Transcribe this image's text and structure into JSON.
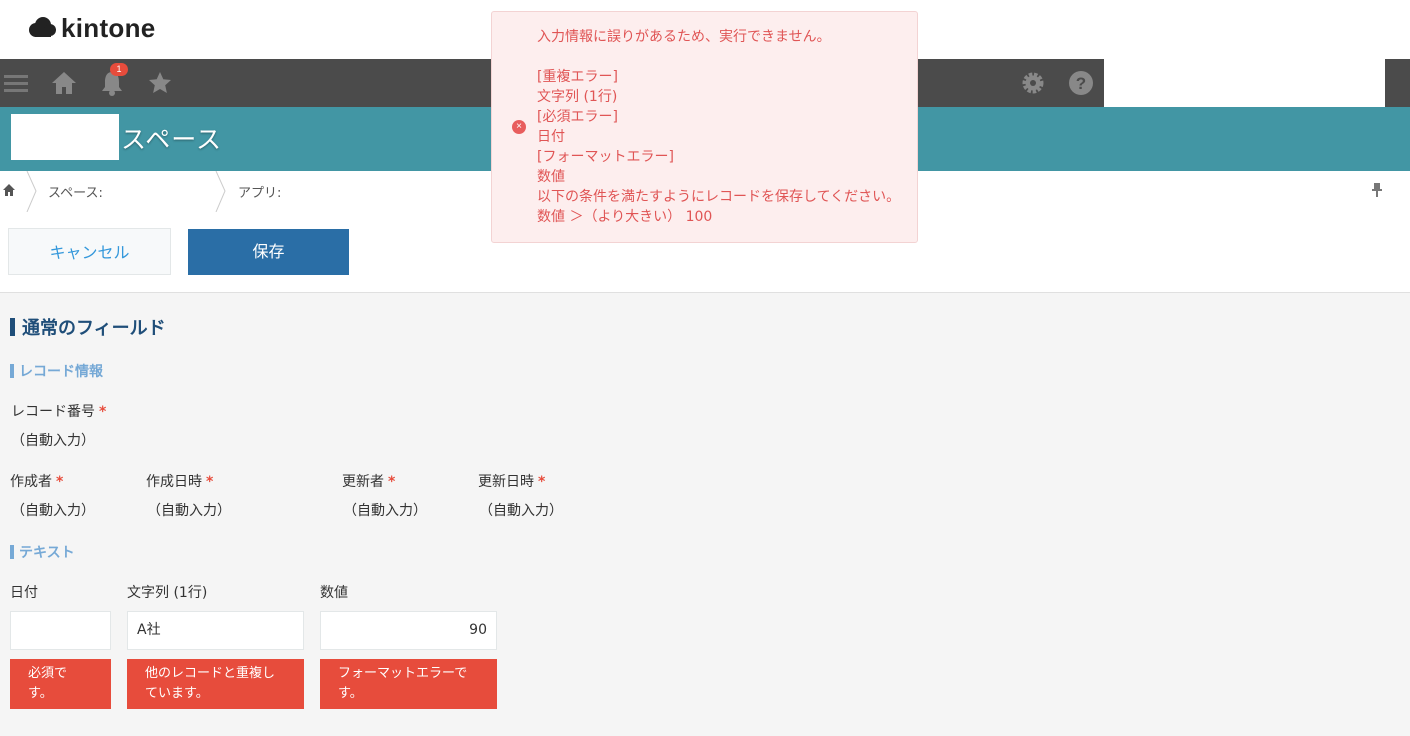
{
  "brand": {
    "name": "kintone"
  },
  "header": {
    "notification_count": "1"
  },
  "space": {
    "title": "スペース"
  },
  "breadcrumb": {
    "space_label": "スペース:",
    "app_label": "アプリ:"
  },
  "toolbar": {
    "cancel_label": "キャンセル",
    "save_label": "保存"
  },
  "form": {
    "section_title": "通常のフィールド",
    "record_info_title": "レコード情報",
    "required_mark": "*",
    "record_number": {
      "label": "レコード番号",
      "value": "（自動入力）"
    },
    "creator": {
      "label": "作成者",
      "value": "（自動入力）"
    },
    "created_at": {
      "label": "作成日時",
      "value": "（自動入力）"
    },
    "updater": {
      "label": "更新者",
      "value": "（自動入力）"
    },
    "updated_at": {
      "label": "更新日時",
      "value": "（自動入力）"
    },
    "text_group_title": "テキスト",
    "date_field": {
      "label": "日付",
      "value": "",
      "error_line1": "必須で",
      "error_line2": "す。"
    },
    "text_field": {
      "label": "文字列 (1行)",
      "value": "A社",
      "error_line1": "他のレコードと重複し",
      "error_line2": "ています。"
    },
    "number_field": {
      "label": "数値",
      "value": "90",
      "error_line1": "フォーマットエラーで",
      "error_line2": "す。"
    }
  },
  "alert": {
    "lines": [
      "入力情報に誤りがあるため、実行できません。",
      "",
      "[重複エラー]",
      "文字列 (1行)",
      "[必須エラー]",
      "日付",
      "[フォーマットエラー]",
      "数値",
      "以下の条件を満たすようにレコードを保存してください。",
      "数値 ＞（より大きい） 100"
    ]
  },
  "colors": {
    "header_bar": "#4b4b4b",
    "space_header": "#4296a4",
    "save_button": "#2a6ea6",
    "error": "#e74c3c",
    "alert_background": "#fdeeee",
    "alert_text": "#e05555"
  },
  "icons": [
    "kintone-cloud-icon",
    "menu-icon",
    "home-icon",
    "bell-icon",
    "star-icon",
    "gear-icon",
    "help-icon",
    "pin-icon",
    "error-icon"
  ]
}
